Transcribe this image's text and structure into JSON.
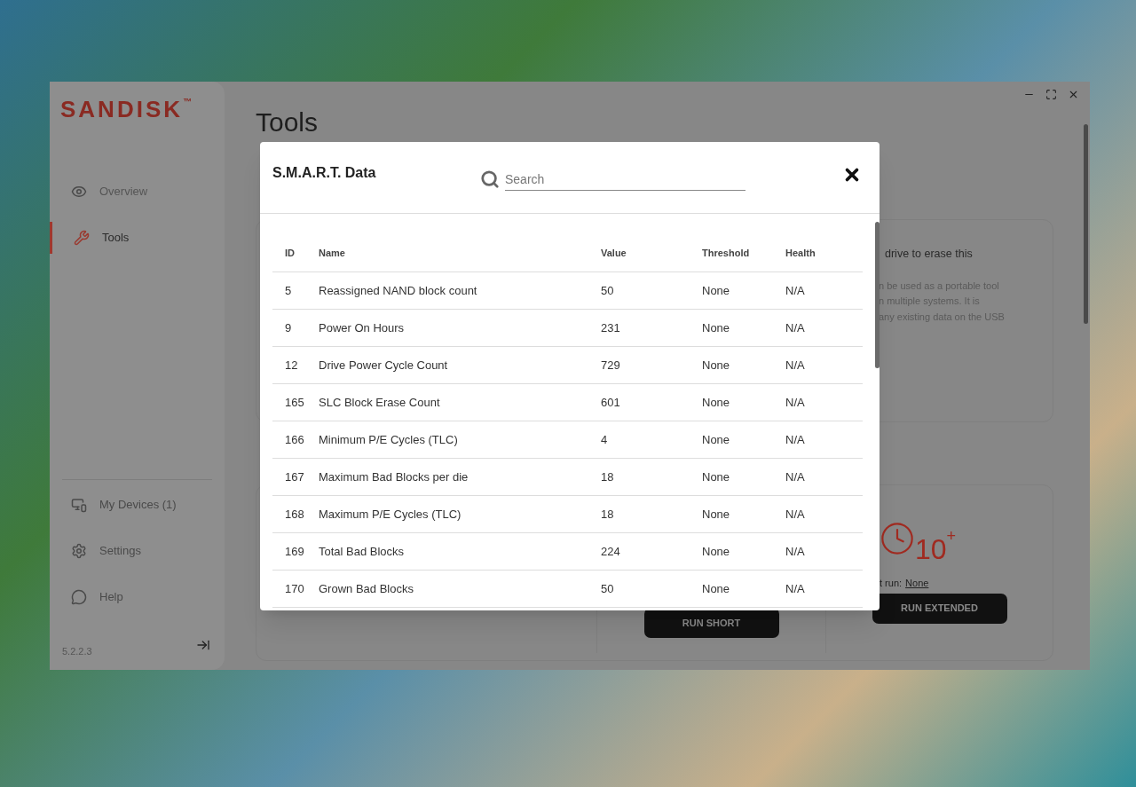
{
  "sidebar": {
    "logo": "SANDISK",
    "logo_mark": "™",
    "items": [
      {
        "label": "Overview",
        "selected": false
      },
      {
        "label": "Tools",
        "selected": true
      }
    ],
    "bottom_items": [
      {
        "label": "My Devices (1)"
      },
      {
        "label": "Settings"
      },
      {
        "label": "Help"
      }
    ],
    "version": "5.2.2.3"
  },
  "page": {
    "title": "Tools",
    "erase_card": {
      "heading": "drive to erase this",
      "lines": [
        "n be used as a portable tool",
        "n multiple systems. It is",
        "any existing data on the USB"
      ]
    },
    "test_card": {
      "estimate": "10",
      "estimate_mark": "+",
      "last_run_label": "t run:",
      "last_run_value": "None",
      "buttons": [
        "RUN SHORT",
        "RUN EXTENDED"
      ]
    }
  },
  "dialog": {
    "title": "S.M.A.R.T. Data",
    "search": {
      "placeholder": "Search"
    },
    "table": {
      "columns": [
        "ID",
        "Name",
        "Value",
        "Threshold",
        "Health"
      ],
      "rows": [
        [
          "5",
          "Reassigned NAND block count",
          "50",
          "None",
          "N/A"
        ],
        [
          "9",
          "Power On Hours",
          "231",
          "None",
          "N/A"
        ],
        [
          "12",
          "Drive Power Cycle Count",
          "729",
          "None",
          "N/A"
        ],
        [
          "165",
          "SLC Block Erase Count",
          "601",
          "None",
          "N/A"
        ],
        [
          "166",
          "Minimum P/E Cycles (TLC)",
          "4",
          "None",
          "N/A"
        ],
        [
          "167",
          "Maximum Bad Blocks per die",
          "18",
          "None",
          "N/A"
        ],
        [
          "168",
          "Maximum P/E Cycles (TLC)",
          "18",
          "None",
          "N/A"
        ],
        [
          "169",
          "Total Bad Blocks",
          "224",
          "None",
          "N/A"
        ],
        [
          "170",
          "Grown Bad Blocks",
          "50",
          "None",
          "N/A"
        ]
      ]
    }
  }
}
